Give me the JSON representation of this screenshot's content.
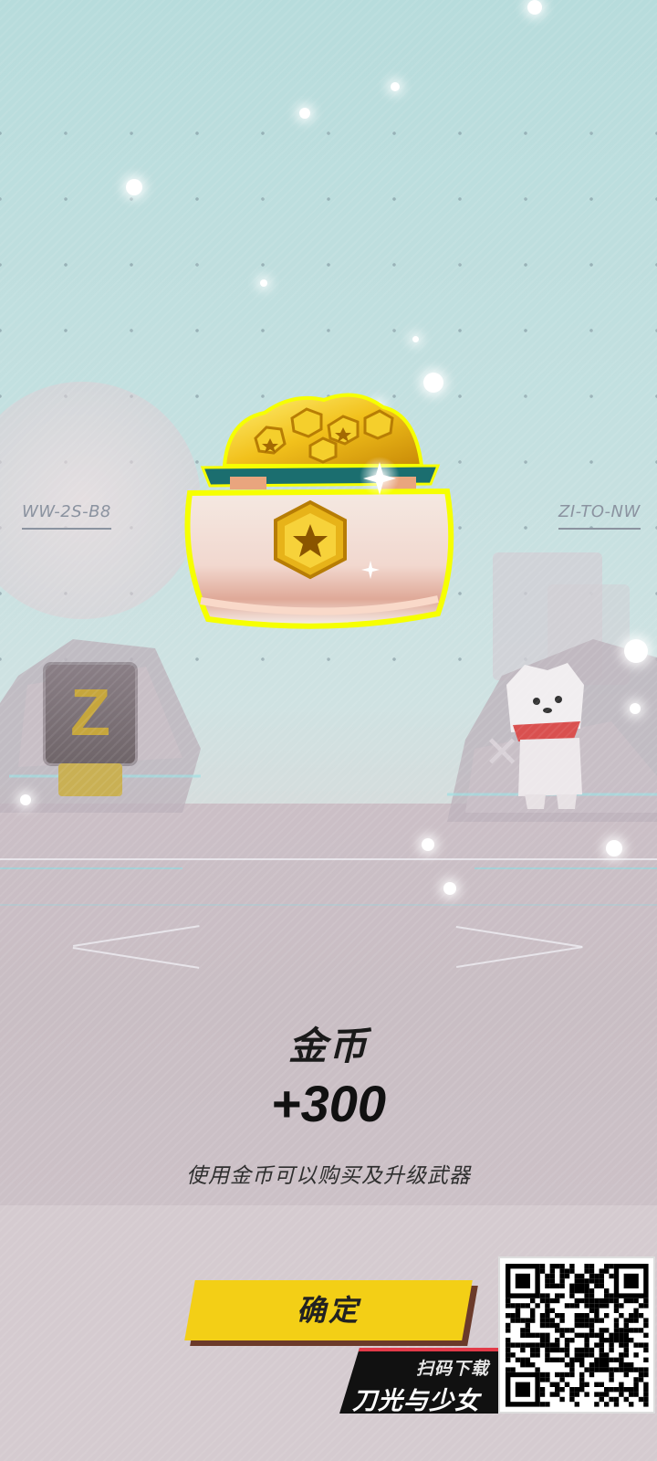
{
  "pads": {
    "left_label": "WW-2S-B8",
    "right_label": "ZI-TO-NW"
  },
  "robot_badge_letter": "Z",
  "reward": {
    "name": "金币",
    "amount": "+300",
    "description": "使用金币可以购买及升级武器",
    "icon": "gold-coin-pot-icon"
  },
  "confirm_button": {
    "label": "确定"
  },
  "promo": {
    "scan_text": "扫码下载",
    "game_title": "刀光与少女",
    "qr_icon": "qr-code-icon"
  },
  "colors": {
    "accent_yellow": "#f3cf16",
    "coin_gold": "#e3b21a",
    "promo_red": "#e23a48"
  }
}
